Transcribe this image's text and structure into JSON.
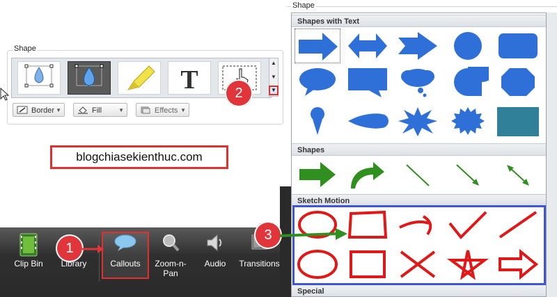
{
  "left_panel": {
    "group_label": "Shape",
    "gallery_items": [
      "shape-preset-selected-outline",
      "shape-preset-drop-blue",
      "shape-preset-highlight",
      "shape-preset-text",
      "shape-preset-cursor-box"
    ],
    "buttons": {
      "border": "Border",
      "fill": "Fill",
      "effects": "Effects"
    }
  },
  "watermark": "blogchiasekienthuc.com",
  "badges": {
    "one": "1",
    "two": "2",
    "three": "3"
  },
  "toolbar": {
    "items": [
      {
        "label": "Clip Bin"
      },
      {
        "label": "Library"
      },
      {
        "label": "Callouts"
      },
      {
        "label": "Zoom-n-\nPan"
      },
      {
        "label": "Audio"
      },
      {
        "label": "Transitions"
      }
    ]
  },
  "right_panel": {
    "frame_label": "Shape",
    "sections": {
      "shapes_with_text": "Shapes with Text",
      "shapes": "Shapes",
      "sketch_motion": "Sketch Motion",
      "special": "Special"
    }
  },
  "colors": {
    "accent_red": "#e03030",
    "badge_red": "#e0353b",
    "highlight_blue": "#3d55d6",
    "shape_blue": "#2e6fd8",
    "sketch_red": "#e01818",
    "arrow_green": "#2f8f1f"
  }
}
